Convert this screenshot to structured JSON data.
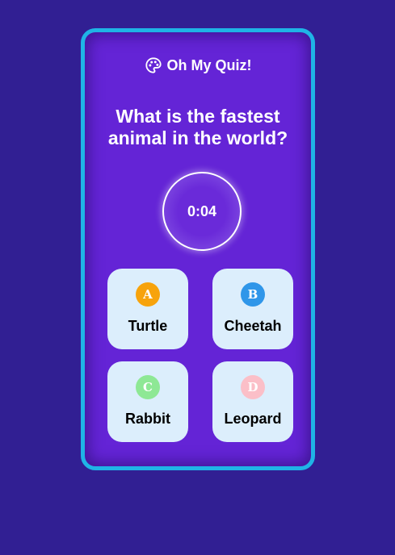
{
  "app": {
    "title": "Oh My Quiz!",
    "icon": "palette-icon"
  },
  "question": {
    "line1": "What is the fastest",
    "line2": "animal in the world?"
  },
  "timer": {
    "value": "0:04"
  },
  "answers": [
    {
      "letter": "A",
      "text": "Turtle",
      "color": "#f7a30c"
    },
    {
      "letter": "B",
      "text": "Cheetah",
      "color": "#2f96e9"
    },
    {
      "letter": "C",
      "text": "Rabbit",
      "color": "#8ee895"
    },
    {
      "letter": "D",
      "text": "Leopard",
      "color": "#fbbfc8"
    }
  ],
  "colors": {
    "background": "#311f93",
    "card": "#6424d6",
    "card_border": "#1fb4e6",
    "answer_bg": "#dceefc"
  }
}
